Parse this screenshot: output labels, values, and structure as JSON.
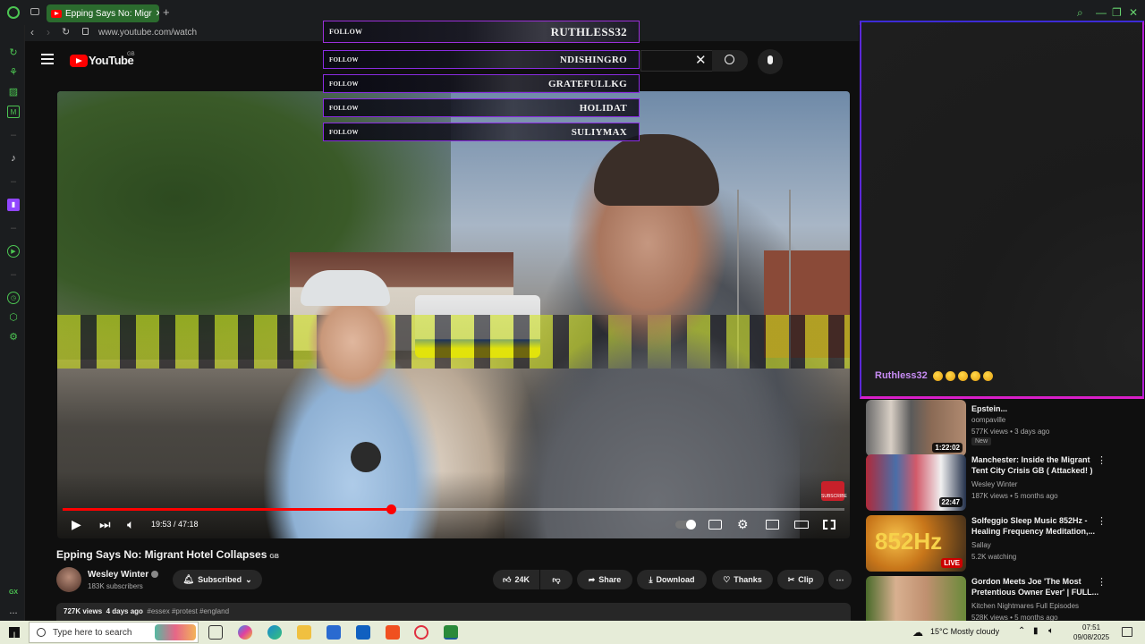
{
  "browser": {
    "tab_title": "Epping Says No: Migr",
    "tab_close": "✕",
    "new_tab": "+",
    "address": "www.youtube.com/watch",
    "sidebar_gx": "GX",
    "sidebar_more": "..."
  },
  "youtube": {
    "logo_text": "YouTube",
    "region": "GB"
  },
  "follow_overlay": [
    {
      "label": "FOLLOW",
      "name": "RUTHLESS32"
    },
    {
      "label": "FOLLOW",
      "name": "NDISHINGRO"
    },
    {
      "label": "FOLLOW",
      "name": "GRATEFULLKG"
    },
    {
      "label": "FOLLOW",
      "name": "HOLIDAT"
    },
    {
      "label": "FOLLOW",
      "name": "SULIYMAX"
    }
  ],
  "player": {
    "time": "19:53 / 47:18",
    "progress": 0.42,
    "subscribe_badge": "SUBSCRIBE"
  },
  "video": {
    "title": "Epping Says No: Migrant Hotel Collapses",
    "title_tag": "GB",
    "channel": "Wesley Winter",
    "subscribers": "183K subscribers",
    "subscribed_label": "Subscribed",
    "likes": "24K",
    "share_label": "Share",
    "download_label": "Download",
    "thanks_label": "Thanks",
    "clip_label": "Clip",
    "views": "727K views",
    "age": "4 days ago",
    "hashtags": "#essex #protest #england"
  },
  "stream_chat": {
    "user": "Ruthless32"
  },
  "recommended": [
    {
      "title": "Epstein...",
      "channel": "oompaville",
      "meta": "577K views • 3 days ago",
      "duration": "1:22:02",
      "badge": "New"
    },
    {
      "title": "Manchester: Inside the Migrant Tent City Crisis  GB ( Attacked! )",
      "channel": "Wesley Winter",
      "meta": "187K views • 5 months ago",
      "duration": "22:47"
    },
    {
      "title": "Solfeggio Sleep Music 852Hz - Healing Frequency Meditation,...",
      "channel": "Sallay",
      "meta": "5.2K watching",
      "live": "LIVE",
      "thumb_text": "852Hz"
    },
    {
      "title": "Gordon Meets Joe 'The Most Pretentious Owner Ever' | FULL...",
      "channel": "Kitchen Nightmares Full Episodes",
      "meta": "528K views • 5 months ago"
    }
  ],
  "taskbar": {
    "search_placeholder": "Type here to search",
    "weather": "15°C  Mostly cloudy",
    "time": "07:51",
    "date": "09/08/2025"
  }
}
